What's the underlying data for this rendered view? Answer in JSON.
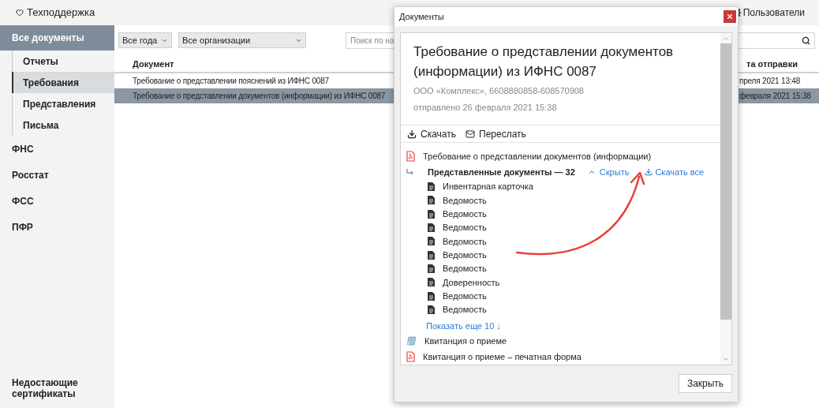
{
  "topbar": {
    "support": "Техподдержка",
    "users": "Пользователи"
  },
  "sidebar": {
    "items": [
      {
        "label": "Все документы",
        "selected": true,
        "children": [
          {
            "label": "Отчеты",
            "selected": false
          },
          {
            "label": "Требования",
            "selected": true
          },
          {
            "label": "Представления",
            "selected": false
          },
          {
            "label": "Письма",
            "selected": false
          }
        ]
      },
      {
        "label": "ФНС",
        "selected": false
      },
      {
        "label": "Росстат",
        "selected": false
      },
      {
        "label": "ФСС",
        "selected": false
      },
      {
        "label": "ПФР",
        "selected": false
      }
    ],
    "footer": "Недостающие сертификаты"
  },
  "filters": {
    "year": "Все года",
    "organization": "Все организации",
    "search": {
      "placeholder": "Поиск по на"
    }
  },
  "table": {
    "columns": [
      "Документ",
      "та отправки"
    ],
    "rows": [
      {
        "document": "Требование о представлении пояснений из ИФНС 0087",
        "date": "преля 2021 13:48",
        "selected": false
      },
      {
        "document": "Требование о представлении документов (информации) из ИФНС 0087",
        "date": "февраля 2021 15:38",
        "selected": true
      }
    ]
  },
  "dialog": {
    "title": "Документы",
    "heading": "Требование о представлении документов (информации) из ИФНС 0087",
    "organization": "ООО «Комплекс», 6608880858-608570908",
    "sent": "отправлено 26 февраля 2021 15:38",
    "actions": [
      {
        "kind": "download",
        "label": "Скачать"
      },
      {
        "kind": "forward",
        "label": "Переслать"
      }
    ],
    "files": [
      {
        "kind": "pdf",
        "name": "Требование о представлении документов (информации)"
      },
      {
        "kind": "group",
        "name": "Представленные документы — 32",
        "collapse": "Скрыть",
        "download_all": "Скачать все",
        "more": "Показать еще 10 ↓",
        "children": [
          "Инвентарная карточка",
          "Ведомость",
          "Ведомость",
          "Ведомость",
          "Ведомость",
          "Ведомость",
          "Ведомость",
          "Доверенность",
          "Ведомость",
          "Ведомость"
        ]
      },
      {
        "kind": "receipt",
        "name": "Квитанция о приеме"
      },
      {
        "kind": "pdf",
        "name": "Квитанция о приеме – печатная форма"
      }
    ],
    "close": "Закрыть"
  }
}
